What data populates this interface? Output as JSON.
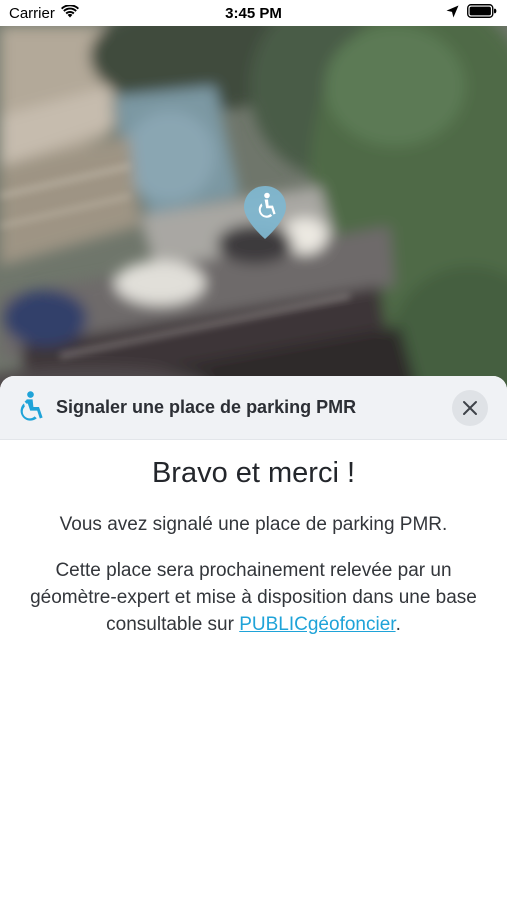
{
  "status_bar": {
    "carrier": "Carrier",
    "time": "3:45 PM"
  },
  "map": {
    "pin_icon": "wheelchair-icon",
    "pin_color": "#7fb6cf"
  },
  "sheet": {
    "header_icon": "wheelchair-icon",
    "title": "Signaler une place de parking PMR",
    "close_icon": "close-icon",
    "heading": "Bravo et merci !",
    "paragraph_1": "Vous avez signalé une place de parking PMR.",
    "paragraph_2_text": "Cette place sera prochainement relevée par un géomètre-expert et mise à disposition dans une base consultable sur ",
    "link_text": "PUBLICgéofoncier",
    "paragraph_2_end": "."
  },
  "colors": {
    "accent": "#1fa3d8",
    "header_bg": "#f0f2f5",
    "close_bg": "#dfe2e6"
  }
}
